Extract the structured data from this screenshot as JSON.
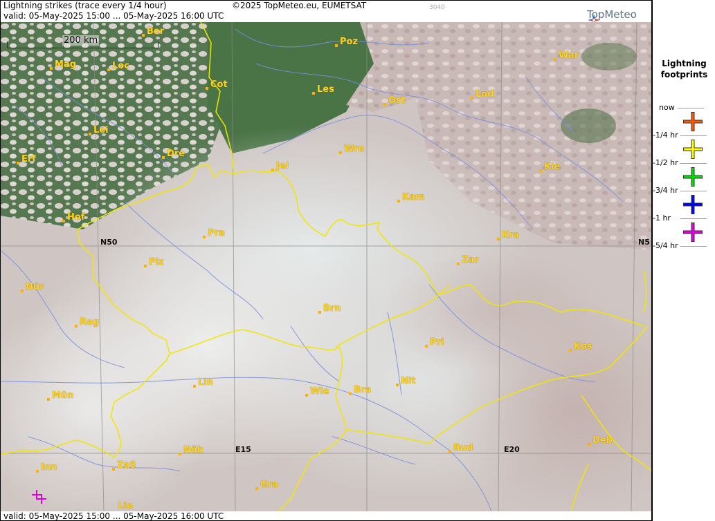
{
  "header": {
    "title": "Lightning strikes (trace every 1/4 hour)",
    "copyright": "©2025 TopMeteo.eu, EUMETSAT",
    "code": "3040",
    "valid_top": "valid:  05-May-2025 15:00 ... 05-May-2025 16:00 UTC",
    "logo": "TopMeteo"
  },
  "footer": {
    "valid_bottom": "valid:  05-May-2025 15:00 ... 05-May-2025 16:00 UTC"
  },
  "map": {
    "scale_label": "200 km",
    "grid_labels": {
      "n50_left": "N50",
      "n50_right": "N5",
      "e15": "E15",
      "e20": "E20"
    },
    "cities": {
      "ber": "Ber",
      "poz": "Poz",
      "war": "War",
      "mag": "Mag",
      "loc": "Loc",
      "cot": "Cot",
      "les": "Les",
      "ost": "Ost",
      "lod": "Lod",
      "lei": "Lei",
      "wro": "Wro",
      "erf": "Erf",
      "dre": "Dre",
      "jel": "Jel",
      "kie": "Kie",
      "kam": "Kam",
      "hof": "Hof",
      "pra": "Pra",
      "kra": "Kra",
      "plz": "Plz",
      "zar": "Zar",
      "nur": "Nür",
      "brn": "Brn",
      "reg": "Reg",
      "pri": "Pri",
      "kos": "Kos",
      "lin": "Lin",
      "mun": "Mün",
      "wie": "Wie",
      "bra": "Bra",
      "nit": "Nit",
      "bud": "Bud",
      "deb": "Deb",
      "nob": "Nöb",
      "inn": "Inn",
      "zas": "ZaS",
      "gra": "Gra",
      "lie": "Lie"
    }
  },
  "legend": {
    "title_line1": "Lightning",
    "title_line2": "footprints",
    "items": [
      {
        "label": "now",
        "color": "#ff5a00"
      },
      {
        "label": "-1/4 hr",
        "color": "#ffff00"
      },
      {
        "label": "-1/2 hr",
        "color": "#00e000"
      },
      {
        "label": "-3/4 hr",
        "color": "#0000ff"
      },
      {
        "label": "-1 hr",
        "color": "#e000e0"
      },
      {
        "label": "-5/4 hr",
        "color": ""
      }
    ]
  }
}
